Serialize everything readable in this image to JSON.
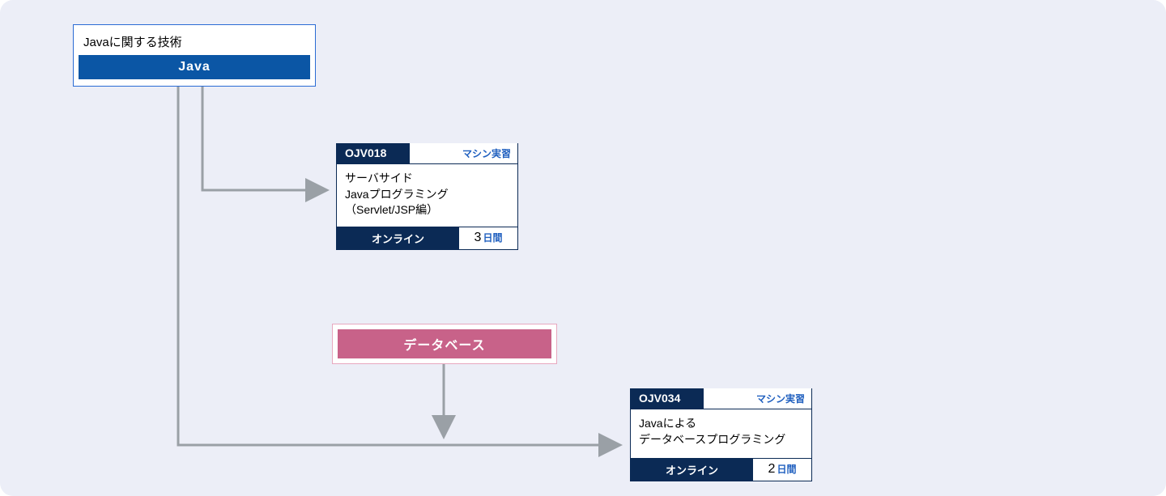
{
  "root": {
    "title": "Javaに関する技術",
    "chip": "Java"
  },
  "db_chip": "データベース",
  "card1": {
    "code": "OJV018",
    "tag": "マシン実習",
    "line1": "サーバサイド",
    "line2": "Javaプログラミング",
    "line3": "（Servlet/JSP編）",
    "mode": "オンライン",
    "dur_n": "3",
    "dur_u": "日間"
  },
  "card2": {
    "code": "OJV034",
    "tag": "マシン実習",
    "line1": "Javaによる",
    "line2": "データベースプログラミング",
    "mode": "オンライン",
    "dur_n": "2",
    "dur_u": "日間"
  }
}
